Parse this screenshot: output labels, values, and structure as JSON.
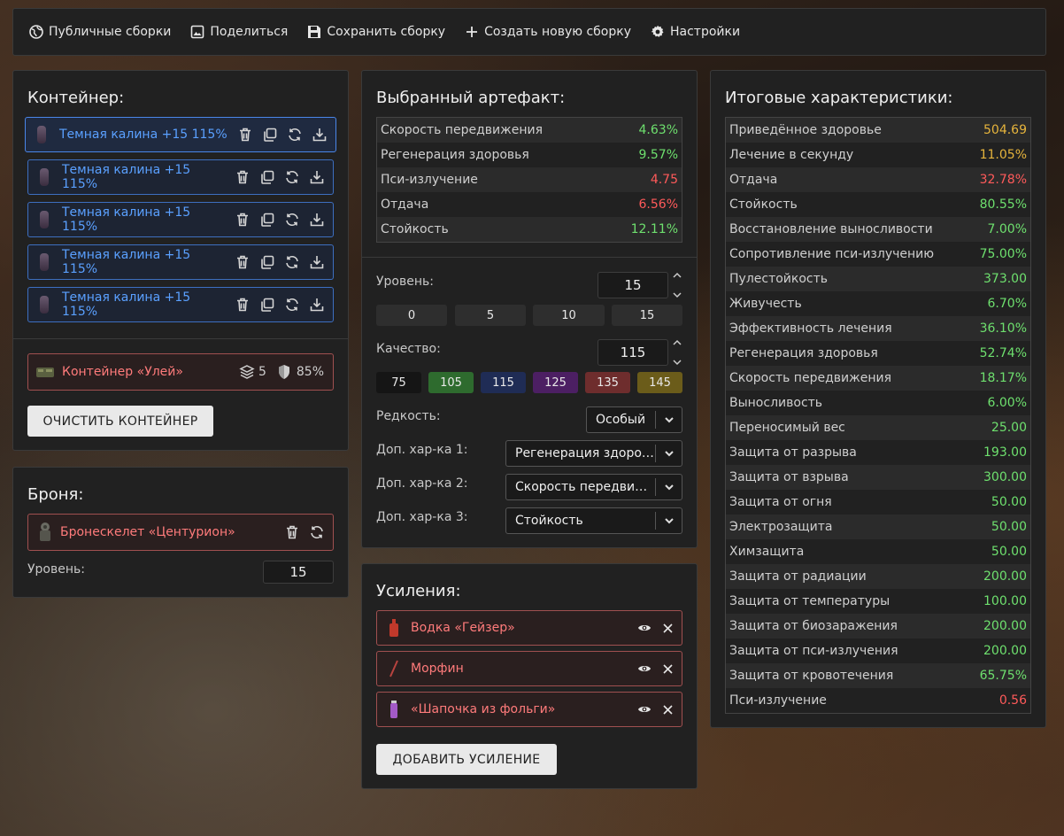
{
  "topbar": {
    "items": [
      {
        "label": "Публичные сборки",
        "icon": "globe-icon"
      },
      {
        "label": "Поделиться",
        "icon": "image-icon"
      },
      {
        "label": "Сохранить сборку",
        "icon": "floppy-icon"
      },
      {
        "label": "Создать новую сборку",
        "icon": "plus-icon"
      },
      {
        "label": "Настройки",
        "icon": "gear-icon"
      }
    ]
  },
  "container": {
    "title": "Контейнер:",
    "artifacts": [
      {
        "name": "Темная калина +15 115%"
      },
      {
        "name": "Темная калина +15 115%"
      },
      {
        "name": "Темная калина +15 115%"
      },
      {
        "name": "Темная калина +15 115%"
      },
      {
        "name": "Темная калина +15 115%"
      }
    ],
    "container_item": {
      "name": "Контейнер «Улей»",
      "slots": "5",
      "protection": "85%"
    },
    "clear_button": "ОЧИСТИТЬ КОНТЕЙНЕР"
  },
  "armor": {
    "title": "Броня:",
    "item": {
      "name": "Бронескелет «Центурион»"
    },
    "level_label": "Уровень:",
    "level_value": "15"
  },
  "artifact": {
    "title": "Выбранный артефакт:",
    "stats": [
      {
        "name": "Скорость передвижения",
        "value": "4.63%",
        "color": "#6ee06e"
      },
      {
        "name": "Регенерация здоровья",
        "value": "9.57%",
        "color": "#6ee06e"
      },
      {
        "name": "Пси-излучение",
        "value": "4.75",
        "color": "#ff5a5a"
      },
      {
        "name": "Отдача",
        "value": "6.56%",
        "color": "#ff5a5a"
      },
      {
        "name": "Стойкость",
        "value": "12.11%",
        "color": "#6ee06e"
      }
    ],
    "level_label": "Уровень:",
    "level_value": "15",
    "level_presets": [
      "0",
      "5",
      "10",
      "15"
    ],
    "quality_label": "Качество:",
    "quality_value": "115",
    "quality_presets": [
      {
        "label": "75",
        "color": "#151515"
      },
      {
        "label": "105",
        "color": "#2e6b2e"
      },
      {
        "label": "115",
        "color": "#1f2c55"
      },
      {
        "label": "125",
        "color": "#4c1f63"
      },
      {
        "label": "135",
        "color": "#6e2d2d"
      },
      {
        "label": "145",
        "color": "#6b5c1a"
      }
    ],
    "rarity_label": "Редкость:",
    "rarity_value": "Особый",
    "extra1_label": "Доп. хар-ка 1:",
    "extra1_value": "Регенерация здоровья",
    "extra2_label": "Доп. хар-ка 2:",
    "extra2_value": "Скорость передвижения",
    "extra3_label": "Доп. хар-ка 3:",
    "extra3_value": "Стойкость"
  },
  "boosts": {
    "title": "Усиления:",
    "items": [
      {
        "name": "Водка «Гейзер»",
        "icon_color": "#c0392b"
      },
      {
        "name": "Морфин",
        "icon_color": "#b8433f"
      },
      {
        "name": "«Шапочка из фольги»",
        "icon_color": "#a35ac7"
      }
    ],
    "add_button": "ДОБАВИТЬ УСИЛЕНИЕ"
  },
  "totals": {
    "title": "Итоговые характеристики:",
    "stats": [
      {
        "name": "Приведённое здоровье",
        "value": "504.69",
        "color": "#e6b43c"
      },
      {
        "name": "Лечение в секунду",
        "value": "11.05%",
        "color": "#e6b43c"
      },
      {
        "name": "Отдача",
        "value": "32.78%",
        "color": "#ff5a5a"
      },
      {
        "name": "Стойкость",
        "value": "80.55%",
        "color": "#6ee06e"
      },
      {
        "name": "Восстановление выносливости",
        "value": "7.00%",
        "color": "#6ee06e"
      },
      {
        "name": "Сопротивление пси-излучению",
        "value": "75.00%",
        "color": "#6ee06e"
      },
      {
        "name": "Пулестойкость",
        "value": "373.00",
        "color": "#6ee06e"
      },
      {
        "name": "Живучесть",
        "value": "6.70%",
        "color": "#6ee06e"
      },
      {
        "name": "Эффективность лечения",
        "value": "36.10%",
        "color": "#6ee06e"
      },
      {
        "name": "Регенерация здоровья",
        "value": "52.74%",
        "color": "#6ee06e"
      },
      {
        "name": "Скорость передвижения",
        "value": "18.17%",
        "color": "#6ee06e"
      },
      {
        "name": "Выносливость",
        "value": "6.00%",
        "color": "#6ee06e"
      },
      {
        "name": "Переносимый вес",
        "value": "25.00",
        "color": "#6ee06e"
      },
      {
        "name": "Защита от разрыва",
        "value": "193.00",
        "color": "#6ee06e"
      },
      {
        "name": "Защита от взрыва",
        "value": "300.00",
        "color": "#6ee06e"
      },
      {
        "name": "Защита от огня",
        "value": "50.00",
        "color": "#6ee06e"
      },
      {
        "name": "Электрозащита",
        "value": "50.00",
        "color": "#6ee06e"
      },
      {
        "name": "Химзащита",
        "value": "50.00",
        "color": "#6ee06e"
      },
      {
        "name": "Защита от радиации",
        "value": "200.00",
        "color": "#6ee06e"
      },
      {
        "name": "Защита от температуры",
        "value": "100.00",
        "color": "#6ee06e"
      },
      {
        "name": "Защита от биозаражения",
        "value": "200.00",
        "color": "#6ee06e"
      },
      {
        "name": "Защита от пси-излучения",
        "value": "200.00",
        "color": "#6ee06e"
      },
      {
        "name": "Защита от кровотечения",
        "value": "65.75%",
        "color": "#6ee06e"
      },
      {
        "name": "Пси-излучение",
        "value": "0.56",
        "color": "#ff5a5a"
      }
    ]
  }
}
